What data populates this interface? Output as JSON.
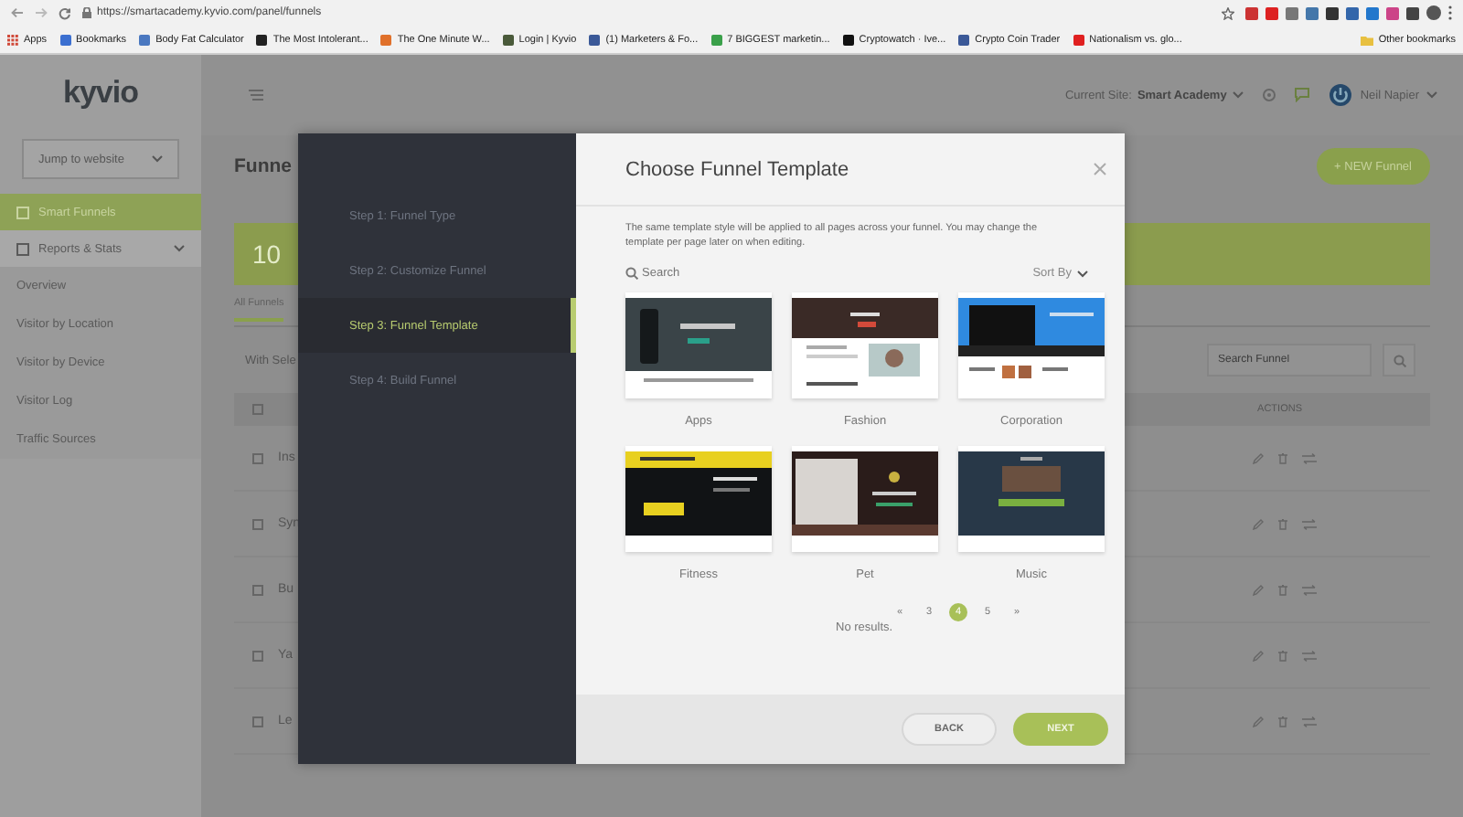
{
  "browser": {
    "url": "https://smartacademy.kyvio.com/panel/funnels",
    "bookmarks": [
      {
        "kind": "apps",
        "label": "Apps",
        "color": "#d04a3a"
      },
      {
        "kind": "link",
        "label": "Bookmarks",
        "color": "#3b6fd0"
      },
      {
        "kind": "link",
        "label": "Body Fat Calculator",
        "color": "#4a78c0"
      },
      {
        "kind": "link",
        "label": "The Most Intolerant...",
        "color": "#222222"
      },
      {
        "kind": "link",
        "label": "The One Minute W...",
        "color": "#e0702a"
      },
      {
        "kind": "link",
        "label": "Login | Kyvio",
        "color": "#4a5a3a"
      },
      {
        "kind": "link",
        "label": "(1) Marketers & Fo...",
        "color": "#3b5998"
      },
      {
        "kind": "link",
        "label": "7 BIGGEST marketin...",
        "color": "#3aa04a"
      },
      {
        "kind": "link",
        "label": "Cryptowatch · Ive...",
        "color": "#111111"
      },
      {
        "kind": "link",
        "label": "Crypto Coin Trader",
        "color": "#3b5998"
      },
      {
        "kind": "link",
        "label": "Nationalism vs. glo...",
        "color": "#e02020"
      },
      {
        "kind": "folder",
        "label": "Other bookmarks",
        "color": "#e8c040"
      }
    ]
  },
  "sidebar": {
    "logo": "kyvio",
    "jump_select": "Jump to website",
    "items": [
      {
        "kind": "main",
        "label": "Smart Funnels",
        "selected": true
      },
      {
        "kind": "section",
        "label": "Reports & Stats",
        "selected": false
      },
      {
        "kind": "sub",
        "label": "Overview",
        "selected": false
      },
      {
        "kind": "sub",
        "label": "Visitor by Location",
        "selected": false
      },
      {
        "kind": "sub",
        "label": "Visitor by Device",
        "selected": false
      },
      {
        "kind": "sub",
        "label": "Visitor Log",
        "selected": false
      },
      {
        "kind": "sub",
        "label": "Traffic Sources",
        "selected": false
      }
    ]
  },
  "header": {
    "current_site_label": "Current Site:",
    "current_site": "Smart Academy",
    "user": "Neil Napier"
  },
  "page": {
    "title": "Funne",
    "new_button": "+ NEW Funnel",
    "banner": "10",
    "tab": "All Funnels",
    "bulk_select": "With Sele",
    "search_placeholder": "Search Funnel",
    "actions_header": "ACTIONS",
    "select_all_checked": false,
    "rows": [
      {
        "name": "Ins",
        "checked": false
      },
      {
        "name": "Syn",
        "checked": false
      },
      {
        "name": "Bu",
        "checked": false
      },
      {
        "name": "Ya",
        "checked": false
      },
      {
        "name": "Le",
        "checked": false
      }
    ]
  },
  "modal": {
    "steps": [
      {
        "label": "Step 1: Funnel Type",
        "selected": false
      },
      {
        "label": "Step 2: Customize Funnel",
        "selected": false
      },
      {
        "label": "Step 3: Funnel Template",
        "selected": true
      },
      {
        "label": "Step 4: Build Funnel",
        "selected": false
      }
    ],
    "title": "Choose Funnel Template",
    "description": "The same template style will be applied to all pages across your funnel. You may change the template per page later on when editing.",
    "search_placeholder": "Search",
    "sort_label": "Sort By",
    "templates": [
      {
        "kind": "apps",
        "name": "Apps"
      },
      {
        "kind": "fashion",
        "name": "Fashion"
      },
      {
        "kind": "corporation",
        "name": "Corporation"
      },
      {
        "kind": "fitness",
        "name": "Fitness"
      },
      {
        "kind": "pet",
        "name": "Pet"
      },
      {
        "kind": "music",
        "name": "Music"
      }
    ],
    "pagination": [
      {
        "label": "«",
        "selected": false
      },
      {
        "label": "3",
        "selected": false
      },
      {
        "label": "4",
        "selected": true
      },
      {
        "label": "5",
        "selected": false
      },
      {
        "label": "»",
        "selected": false
      }
    ],
    "empty_text": "No results.",
    "back": "BACK",
    "next": "NEXT"
  }
}
